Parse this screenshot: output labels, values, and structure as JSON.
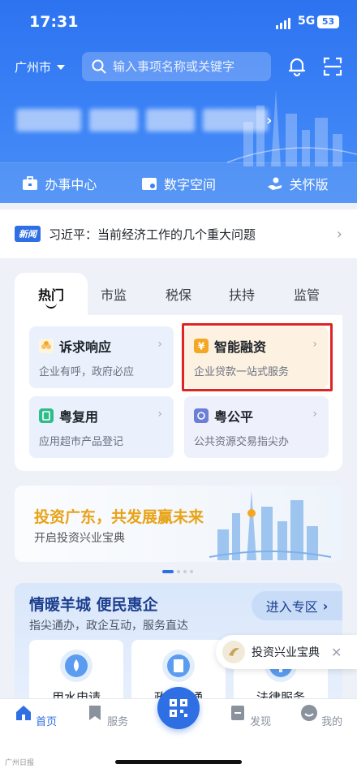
{
  "status": {
    "time": "17:31",
    "network": "5G",
    "battery": "53"
  },
  "header": {
    "city": "广州市",
    "search_placeholder": "输入事项名称或关键字"
  },
  "quicknav": [
    {
      "label": "办事中心",
      "icon": "briefcase-icon"
    },
    {
      "label": "数字空间",
      "icon": "folder-icon"
    },
    {
      "label": "关怀版",
      "icon": "care-hand-icon"
    }
  ],
  "news": {
    "tag": "新闻",
    "text": "习近平：当前经济工作的几个重大问题"
  },
  "hot": {
    "tabs": [
      "热门",
      "市监",
      "税保",
      "扶持",
      "监管"
    ],
    "services": [
      {
        "title": "诉求响应",
        "subtitle": "企业有呼，政府必应",
        "icon": "flower-icon",
        "color": "#f5a623"
      },
      {
        "title": "智能融资",
        "subtitle": "企业贷款一站式服务",
        "icon": "yuan-icon",
        "color": "#f5a623"
      },
      {
        "title": "粤复用",
        "subtitle": "应用超市产品登记",
        "icon": "reuse-icon",
        "color": "#2dbd8a"
      },
      {
        "title": "粤公平",
        "subtitle": "公共资源交易指尖办",
        "icon": "fair-icon",
        "color": "#6b7fd7"
      }
    ]
  },
  "invest": {
    "title": "投资广东，共发展赢未来",
    "subtitle": "开启投资兴业宝典"
  },
  "warm": {
    "title": "情暖羊城 便民惠企",
    "subtitle": "指尖通办，政企互动，服务直达",
    "enter": "进入专区",
    "items": [
      "用水申请",
      "政策直通",
      "法律服务"
    ]
  },
  "toast": {
    "label": "投资兴业宝典"
  },
  "bottom_nav": [
    {
      "label": "首页",
      "icon": "home-icon"
    },
    {
      "label": "服务",
      "icon": "bookmark-icon"
    },
    {
      "label": "发现",
      "icon": "discover-icon"
    },
    {
      "label": "我的",
      "icon": "profile-icon"
    }
  ],
  "watermark": "广州日报",
  "colors": {
    "primary": "#2f6fe4",
    "highlight": "#e02424",
    "gold": "#e8a317"
  }
}
